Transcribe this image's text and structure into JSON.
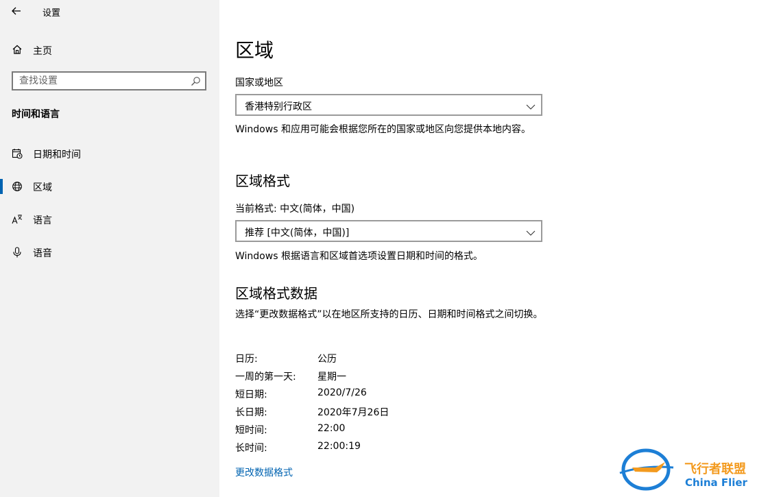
{
  "window": {
    "title": "设置"
  },
  "sidebar": {
    "home_label": "主页",
    "search_placeholder": "查找设置",
    "section_title": "时间和语言",
    "items": [
      {
        "label": "日期和时间",
        "icon": "calendar-clock-icon",
        "active": false
      },
      {
        "label": "区域",
        "icon": "globe-region-icon",
        "active": true
      },
      {
        "label": "语言",
        "icon": "language-icon",
        "active": false
      },
      {
        "label": "语音",
        "icon": "microphone-icon",
        "active": false
      }
    ]
  },
  "main": {
    "title": "区域",
    "country": {
      "label": "国家或地区",
      "value": "香港特别行政区",
      "description": "Windows 和应用可能会根据您所在的国家或地区向您提供本地内容。"
    },
    "format": {
      "heading": "区域格式",
      "current_label": "当前格式: 中文(简体，中国)",
      "value": "推荐 [中文(简体，中国)]",
      "description": "Windows 根据语言和区域首选项设置日期和时间的格式。"
    },
    "format_data": {
      "heading": "区域格式数据",
      "description": "选择“更改数据格式”以在地区所支持的日历、日期和时间格式之间切换。",
      "rows": [
        {
          "key": "日历:",
          "value": "公历"
        },
        {
          "key": "一周的第一天:",
          "value": "星期一"
        },
        {
          "key": "短日期:",
          "value": "2020/7/26"
        },
        {
          "key": "长日期:",
          "value": "2020年7月26日"
        },
        {
          "key": "短时间:",
          "value": "22:00"
        },
        {
          "key": "长时间:",
          "value": "22:00:19"
        }
      ],
      "link": "更改数据格式"
    }
  },
  "watermark": {
    "cn": "飞行者联盟",
    "en": "China Flier"
  },
  "colors": {
    "accent": "#0063b1",
    "sidebar_bg": "#f2f2f2",
    "watermark_blue": "#1d7fd6",
    "watermark_orange": "#f39a1e"
  }
}
